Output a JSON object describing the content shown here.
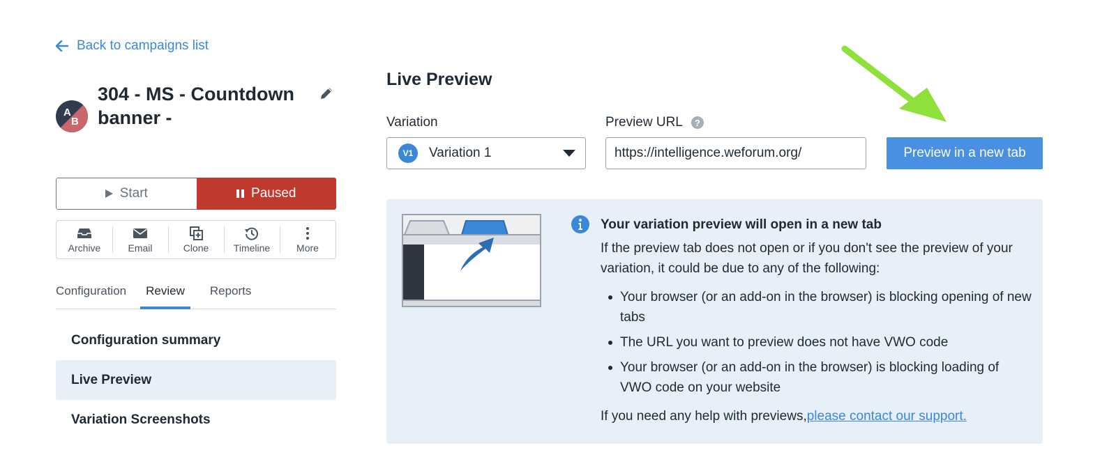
{
  "nav": {
    "back_label": "Back to campaigns list"
  },
  "campaign": {
    "title": "304 - MS - Countdown banner -",
    "avatar_letters": "AB",
    "colors": {
      "avatar_a": "#2f3b4e",
      "avatar_b": "#c9656b"
    }
  },
  "state": {
    "start_label": "Start",
    "paused_label": "Paused",
    "paused_color": "#c0392f"
  },
  "actions": [
    {
      "label": "Archive",
      "icon": "archive-icon"
    },
    {
      "label": "Email",
      "icon": "email-icon"
    },
    {
      "label": "Clone",
      "icon": "clone-icon"
    },
    {
      "label": "Timeline",
      "icon": "timeline-icon"
    },
    {
      "label": "More",
      "icon": "more-icon"
    }
  ],
  "tabs": [
    {
      "label": "Configuration",
      "active": false
    },
    {
      "label": "Review",
      "active": true
    },
    {
      "label": "Reports",
      "active": false
    }
  ],
  "side_menu": [
    {
      "label": "Configuration summary",
      "active": false
    },
    {
      "label": "Live Preview",
      "active": true
    },
    {
      "label": "Variation Screenshots",
      "active": false
    }
  ],
  "live_preview": {
    "title": "Live Preview",
    "variation_label": "Variation",
    "variation_badge": "V1",
    "variation_value": "Variation 1",
    "url_label": "Preview URL",
    "url_help": "?",
    "url_value": "https://intelligence.weforum.org/",
    "preview_button": "Preview in a new tab",
    "accent": "#4a90e2",
    "annotation_arrow_color": "#8ee03a"
  },
  "info": {
    "heading": "Your variation preview will open in a new tab",
    "intro": "If the preview tab does not open or if you don't see the preview of your variation, it could be due to any of the following:",
    "reasons": [
      "Your browser (or an add-on in the browser) is blocking opening of new tabs",
      "The URL you want to preview does not have VWO code",
      "Your browser (or an add-on in the browser) is blocking loading of VWO code on your website"
    ],
    "foot_text": "If you need any help with previews,",
    "support_link": "please contact our support."
  }
}
